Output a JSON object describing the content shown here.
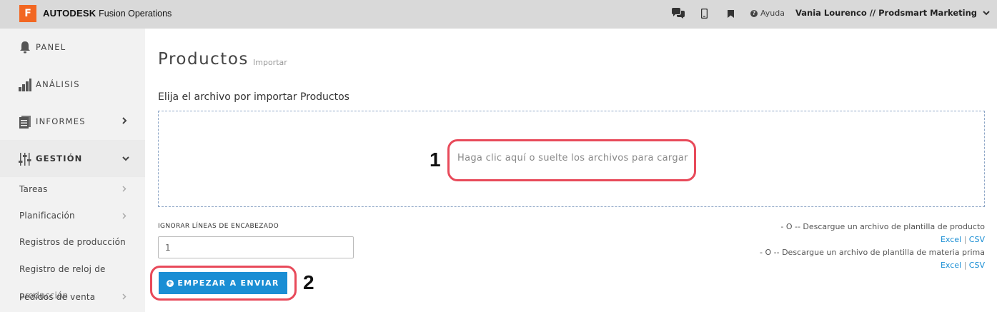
{
  "topbar": {
    "logo_letter": "F",
    "brand_bold": "AUTODESK",
    "brand_product": "Fusion Operations",
    "icons": [
      "chat-icon",
      "mobile-icon",
      "bookmark-icon"
    ],
    "help_label": "Ayuda",
    "user_label": "Vania Lourenco // Prodsmart Marketing"
  },
  "sidebar": {
    "items": [
      {
        "label": "PANEL",
        "icon": "bell-icon"
      },
      {
        "label": "ANÁLISIS",
        "icon": "bar-chart-icon"
      },
      {
        "label": "INFORMES",
        "icon": "document-icon"
      },
      {
        "label": "GESTIÓN",
        "icon": "sliders-icon"
      }
    ],
    "sub_items": [
      {
        "label": "Tareas"
      },
      {
        "label": "Planificación"
      },
      {
        "label": "Registros de producción"
      },
      {
        "label": "Registro de reloj de"
      },
      {
        "label": "Pedidos de venta"
      }
    ],
    "overlap_label": "producción"
  },
  "main": {
    "title": "Productos",
    "subtitle": "Importar",
    "section_label": "Elija el archivo por importar Productos",
    "dropzone_text": "Haga clic aquí o suelte los archivos para cargar",
    "header_lines_label": "IGNORAR LÍNEAS DE ENCABEZADO",
    "header_lines_value": "1",
    "submit_label": "EMPEZAR A ENVIAR",
    "template_product": "- O -- Descargue un archivo de plantilla de producto",
    "template_material": "- O -- Descargue un archivo de plantilla de materia prima",
    "excel_label": "Excel",
    "csv_label": "CSV",
    "separator": "|"
  },
  "annotations": {
    "step1": "1",
    "step2": "2"
  },
  "colors": {
    "brand_orange": "#f26722",
    "accent_blue": "#1a8ed4",
    "annotation_red": "#e84a5a"
  }
}
